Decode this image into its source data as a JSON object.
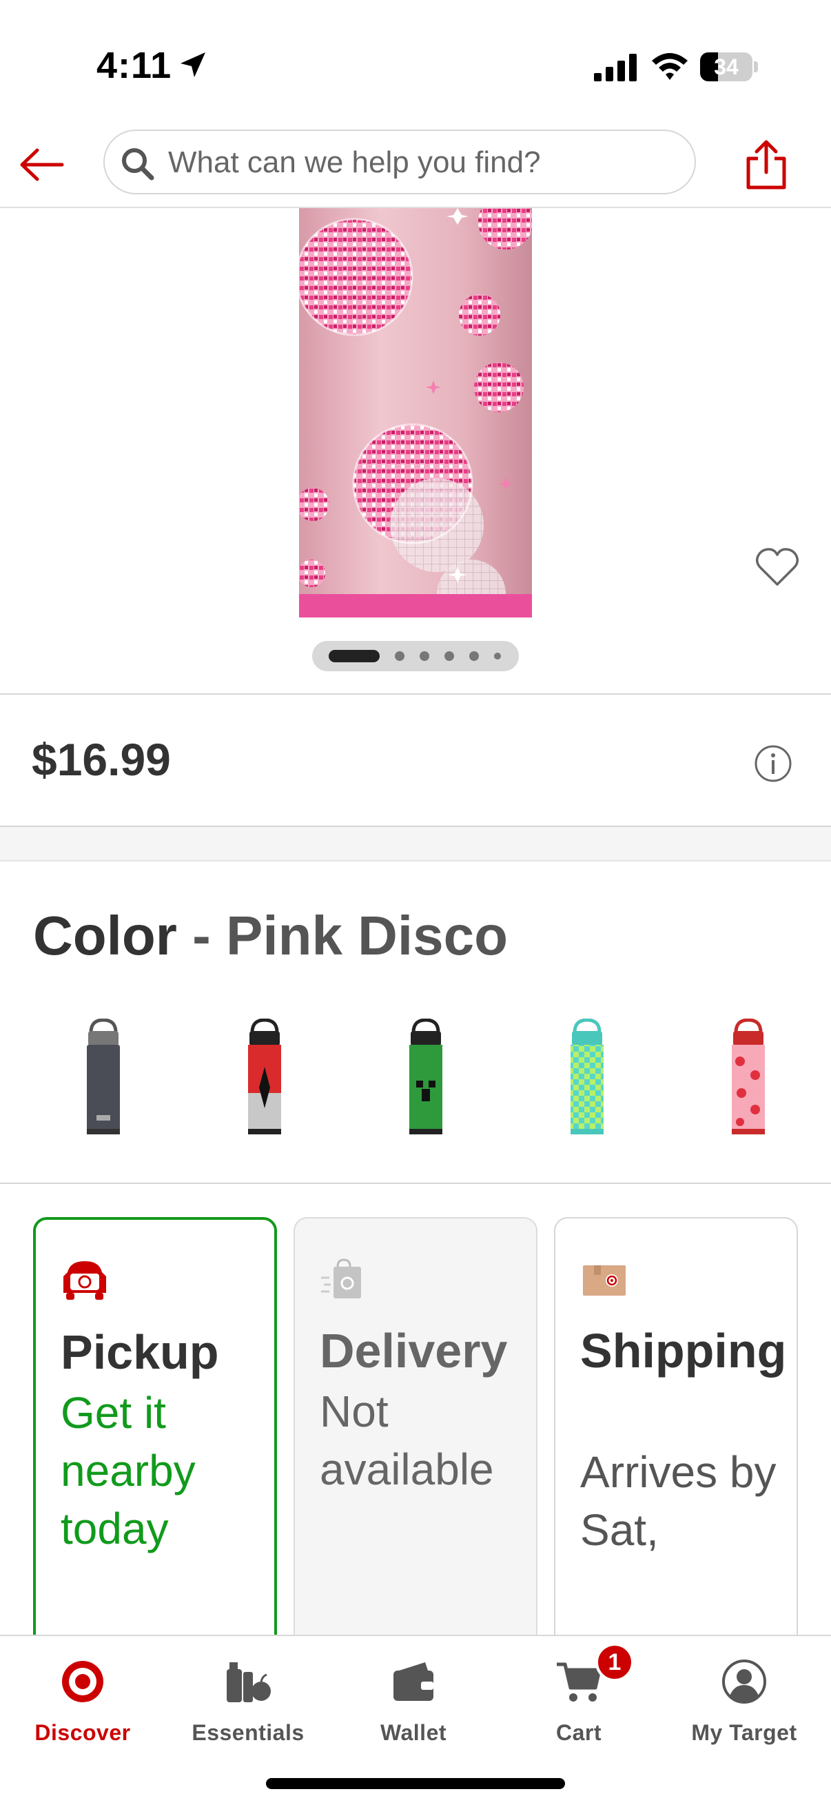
{
  "status_bar": {
    "time": "4:11",
    "battery": "34",
    "battery_level": 0.34
  },
  "nav": {
    "search_placeholder": "What can we help you find?"
  },
  "product": {
    "image_count": 6,
    "active_image": 0,
    "price": "$16.99"
  },
  "color": {
    "label": "Color",
    "separator": "-",
    "selected": "Pink Disco",
    "swatch_count": 5
  },
  "fulfillment": {
    "pickup": {
      "title": "Pickup",
      "subtitle": "Get it nearby today"
    },
    "delivery": {
      "title": "Delivery",
      "subtitle": "Not available"
    },
    "shipping": {
      "title": "Shipping",
      "subtitle": "Arrives by Sat,"
    }
  },
  "tabs": [
    {
      "label": "Discover",
      "icon": "target-bullseye-icon"
    },
    {
      "label": "Essentials",
      "icon": "essentials-icon"
    },
    {
      "label": "Wallet",
      "icon": "wallet-icon"
    },
    {
      "label": "Cart",
      "icon": "cart-icon"
    },
    {
      "label": "My Target",
      "icon": "account-icon"
    }
  ],
  "cart_badge": "1",
  "colors": {
    "brand_red": "#cc0000",
    "pickup_green": "#119a1c",
    "text_dark": "#333333"
  }
}
